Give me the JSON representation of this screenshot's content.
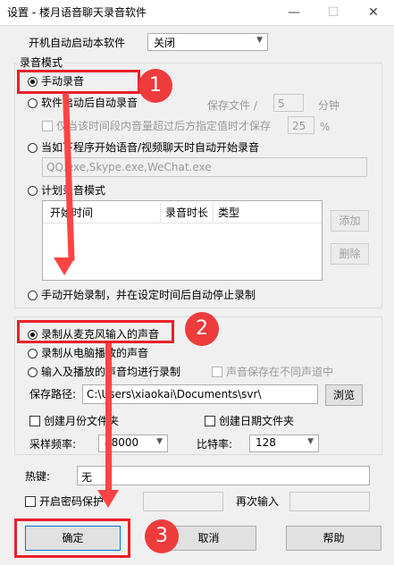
{
  "window": {
    "title": "设置 - 楼月语音聊天录音软件",
    "minimize": "—",
    "maximize": "☐",
    "close": "✕"
  },
  "startup": {
    "label": "开机自动启动本软件",
    "value": "关闭"
  },
  "record_mode": {
    "group_label": "录音模式",
    "manual": "手动录音",
    "auto_start": "软件启动后自动录音",
    "save_file_label": "保存文件 /",
    "save_file_value": "5",
    "save_file_unit": "分钟",
    "silence_label": "仅当该时间段内音量超过后方指定值时才保存",
    "silence_value": "25",
    "silence_unit": "%",
    "on_chat": "当如下程序开始语音/视频聊天时自动开始录音",
    "programs": "QQ.exe,Skype.exe,WeChat.exe",
    "schedule": "计划录音模式",
    "table_headers": [
      "开始时间",
      "录音时长",
      "类型"
    ],
    "add": "添加",
    "delete": "删除",
    "manual_timed": "手动开始录制，并在设定时间后自动停止录制"
  },
  "source": {
    "mic": "录制从麦克风输入的声音",
    "speaker": "录制从电脑播放的声音",
    "both": "输入及播放的声音均进行录制",
    "separate_channels": "声音保存在不同声道中"
  },
  "path": {
    "label": "保存路径:",
    "value": "C:\\Users\\xiaokai\\Documents\\svr\\",
    "browse": "浏览"
  },
  "folders": {
    "month": "创建月份文件夹",
    "date": "创建日期文件夹"
  },
  "rates": {
    "sample_label": "采样频率:",
    "sample_value": "48000",
    "bit_label": "比特率:",
    "bit_value": "128"
  },
  "hotkey": {
    "label": "热键:",
    "value": "无"
  },
  "password": {
    "label": "开启密码保护",
    "repeat_label": "再次输入"
  },
  "buttons": {
    "ok": "确定",
    "cancel": "取消",
    "help": "帮助"
  },
  "annotations": [
    "1",
    "2",
    "3"
  ],
  "colors": {
    "highlight": "#e8202a",
    "background": "#f0f0f0"
  }
}
